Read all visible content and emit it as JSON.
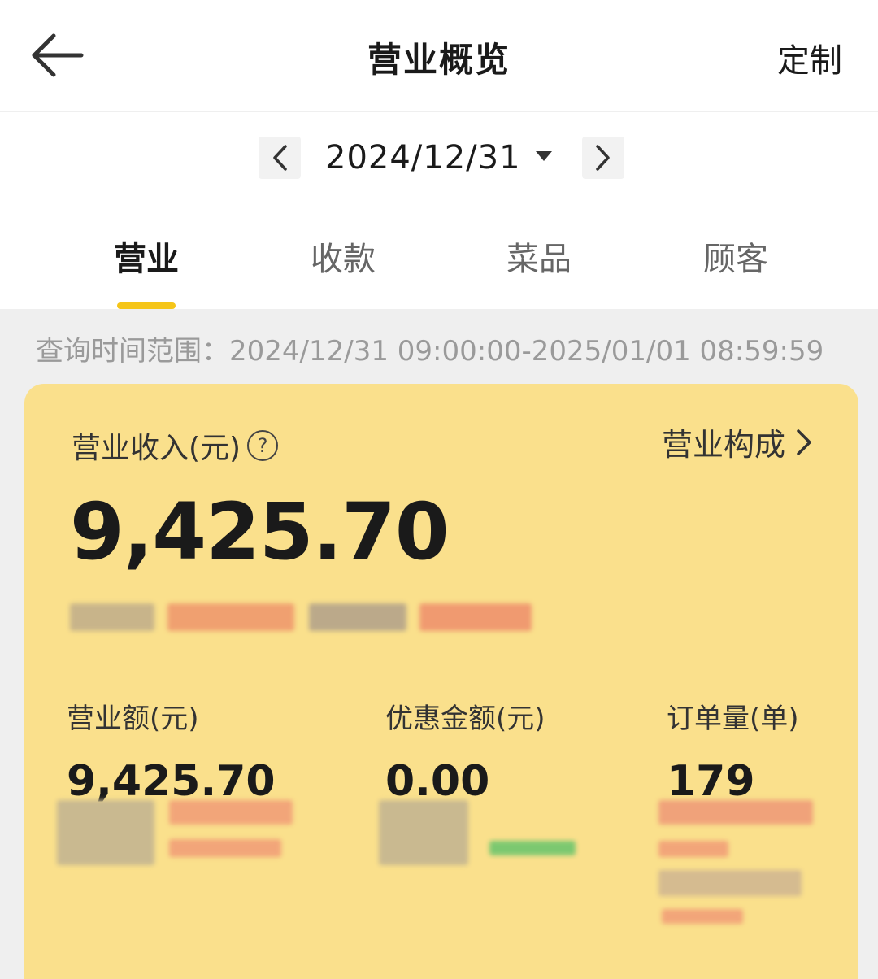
{
  "header": {
    "title": "营业概览",
    "customize_label": "定制",
    "back_icon": "arrow-left-icon"
  },
  "date_selector": {
    "date": "2024/12/31",
    "prev_icon": "chevron-left-icon",
    "next_icon": "chevron-right-icon",
    "dropdown_icon": "caret-down-icon"
  },
  "tabs": [
    {
      "label": "营业",
      "active": true
    },
    {
      "label": "收款",
      "active": false
    },
    {
      "label": "菜品",
      "active": false
    },
    {
      "label": "顾客",
      "active": false
    }
  ],
  "query_range": "查询时间范围：2024/12/31 09:00:00-2025/01/01 08:59:59",
  "summary": {
    "revenue_label": "营业收入(元)",
    "help_icon": "question-circle-icon",
    "composition_label": "营业构成",
    "revenue_amount": "9,425.70",
    "accent_color": "#f5c518",
    "card_color": "#fae08c"
  },
  "metrics": [
    {
      "label": "营业额(元)",
      "value": "9,425.70"
    },
    {
      "label": "优惠金额(元)",
      "value": "0.00"
    },
    {
      "label": "订单量(单)",
      "value": "179"
    }
  ]
}
